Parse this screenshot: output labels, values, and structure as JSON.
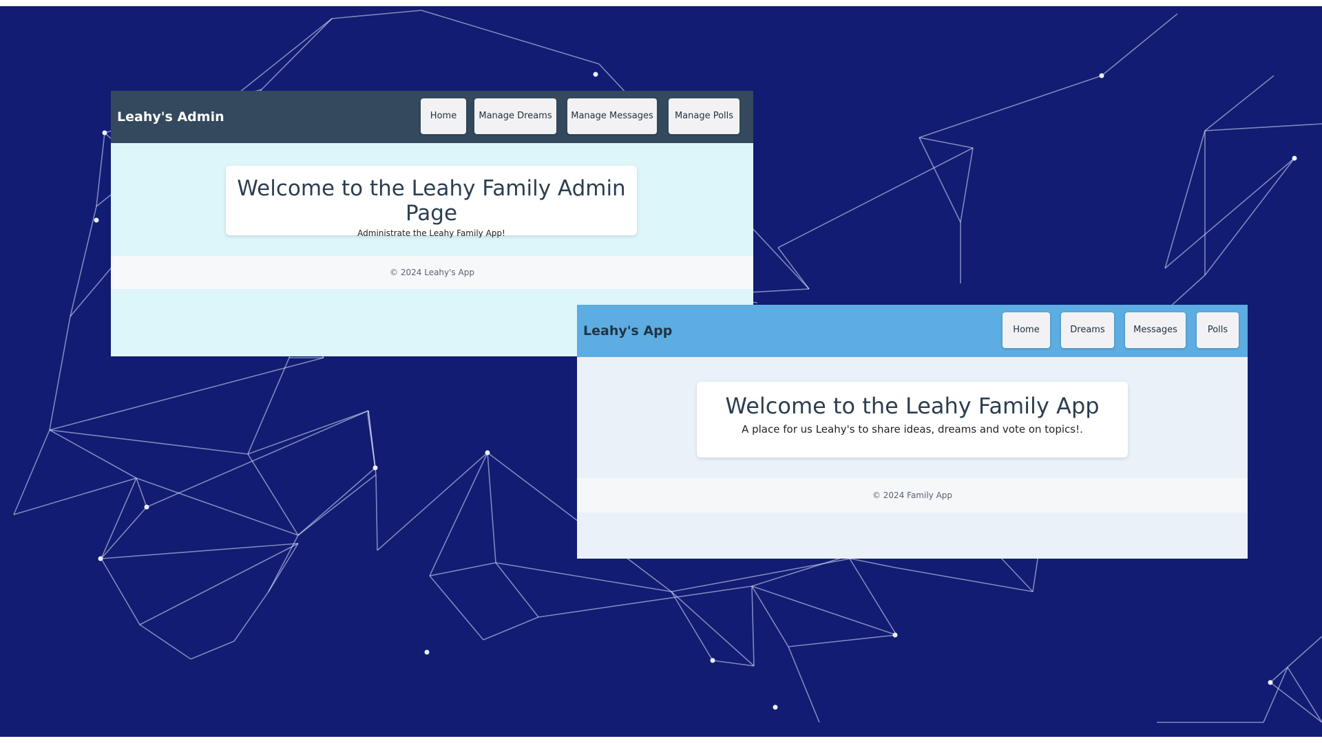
{
  "admin": {
    "brand": "Leahy's Admin",
    "nav": [
      "Home",
      "Manage Dreams",
      "Manage Messages",
      "Manage Polls"
    ],
    "heading": "Welcome to the Leahy Family Admin Page",
    "subheading": "Administrate the Leahy Family App!",
    "footer": "© 2024 Leahy's App"
  },
  "app": {
    "brand": "Leahy's App",
    "nav": [
      "Home",
      "Dreams",
      "Messages",
      "Polls"
    ],
    "heading": "Welcome to the Leahy Family App",
    "subheading": "A place for us Leahy's to share ideas, dreams and vote on topics!.",
    "footer": "© 2024 Family App"
  },
  "colors": {
    "background": "#111c72",
    "admin_navbar": "#34495e",
    "app_navbar": "#5dade2",
    "admin_body": "#ddf6fa",
    "app_body": "#ebf1f8"
  }
}
